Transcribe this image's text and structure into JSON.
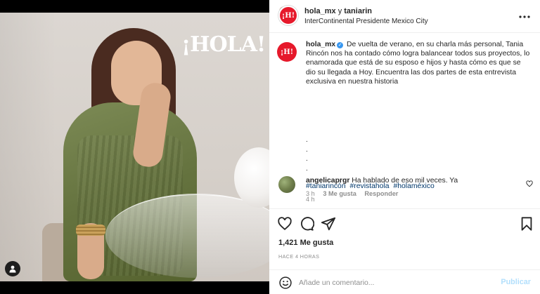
{
  "media": {
    "logo_text": "¡HOLA!"
  },
  "header": {
    "username": "hola_mx",
    "connector": "y",
    "collaborator": "taniarin",
    "location": "InterContinental Presidente Mexico City",
    "avatar_text": "¡H!",
    "more_icon": "more-horizontal-icon"
  },
  "caption": {
    "avatar_text": "¡H!",
    "username": "hola_mx",
    "text": "De vuelta de verano, en su charla más personal, Tania Rincón nos ha contado cómo logra balancear todos sus proyectos, lo enamorada que está de su esposo e hijos y hasta cómo es que se dio su llegada a Hoy. Encuentra las dos partes de esta entrevista exclusiva en nuestra historia",
    "dots": [
      ".",
      ".",
      ".",
      ".",
      "."
    ],
    "hashtags": [
      "#taniarincón",
      "#revistahola",
      "#holaméxico"
    ],
    "time": "4 h"
  },
  "comment": {
    "username": "angelicaprgr",
    "text": "Ha hablado de eso mil veces. Ya",
    "time": "3 h",
    "likes": "3 Me gusta",
    "reply": "Responder"
  },
  "actions": {
    "icons": [
      "heart-icon",
      "comment-icon",
      "share-icon",
      "bookmark-icon"
    ]
  },
  "likes": "1,421 Me gusta",
  "post_time": "HACE 4 HORAS",
  "add_comment": {
    "placeholder": "Añade un comentario...",
    "publish_label": "Publicar"
  },
  "colors": {
    "brand_red": "#e6192b",
    "link_blue": "#00376b",
    "publish_disabled": "#b2dffc",
    "verified_blue": "#3897f0"
  }
}
